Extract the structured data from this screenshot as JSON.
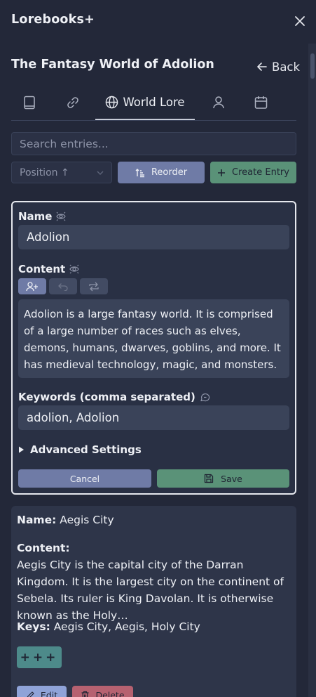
{
  "app": {
    "title": "Lorebooks+"
  },
  "book": {
    "title": "The Fantasy World of Adolion",
    "back_label": "Back"
  },
  "tabs": [
    {
      "icon": "book-icon"
    },
    {
      "icon": "link-icon"
    },
    {
      "icon": "globe-icon",
      "label": "World Lore",
      "active": true
    },
    {
      "icon": "person-icon"
    },
    {
      "icon": "calendar-icon"
    }
  ],
  "search": {
    "placeholder": "Search entries..."
  },
  "controls": {
    "sort_label": "Position ↑",
    "reorder_label": "Reorder",
    "create_label": "Create Entry"
  },
  "edit_form": {
    "name_label": "Name",
    "name_value": "Adolion",
    "content_label": "Content",
    "content_value": "Adolion is a large fantasy world. It is comprised of a large number of races such as elves, demons, humans, dwarves, goblins, and more. It has medieval technology, magic, and monsters.",
    "keywords_label": "Keywords (comma separated)",
    "keywords_value": "adolion, Adolion",
    "advanced_label": "Advanced Settings",
    "cancel_label": "Cancel",
    "save_label": "Save"
  },
  "entry": {
    "name_label": "Name:",
    "name_value": "Aegis City",
    "content_label": "Content:",
    "content_value": "Aegis City is the capital city of the Darran Kingdom. It is the largest city on the continent of Sebela. Its ruler is King Davolan. It is otherwise known as the Holy…",
    "keys_label": "Keys:",
    "keys_value": "Aegis City, Aegis, Holy City",
    "expand_label": "+++",
    "edit_label": "Edit",
    "delete_label": "Delete"
  },
  "colors": {
    "background": "#232839",
    "primary": "#6f7ba6",
    "success": "#5a9278",
    "danger": "#b66170"
  }
}
